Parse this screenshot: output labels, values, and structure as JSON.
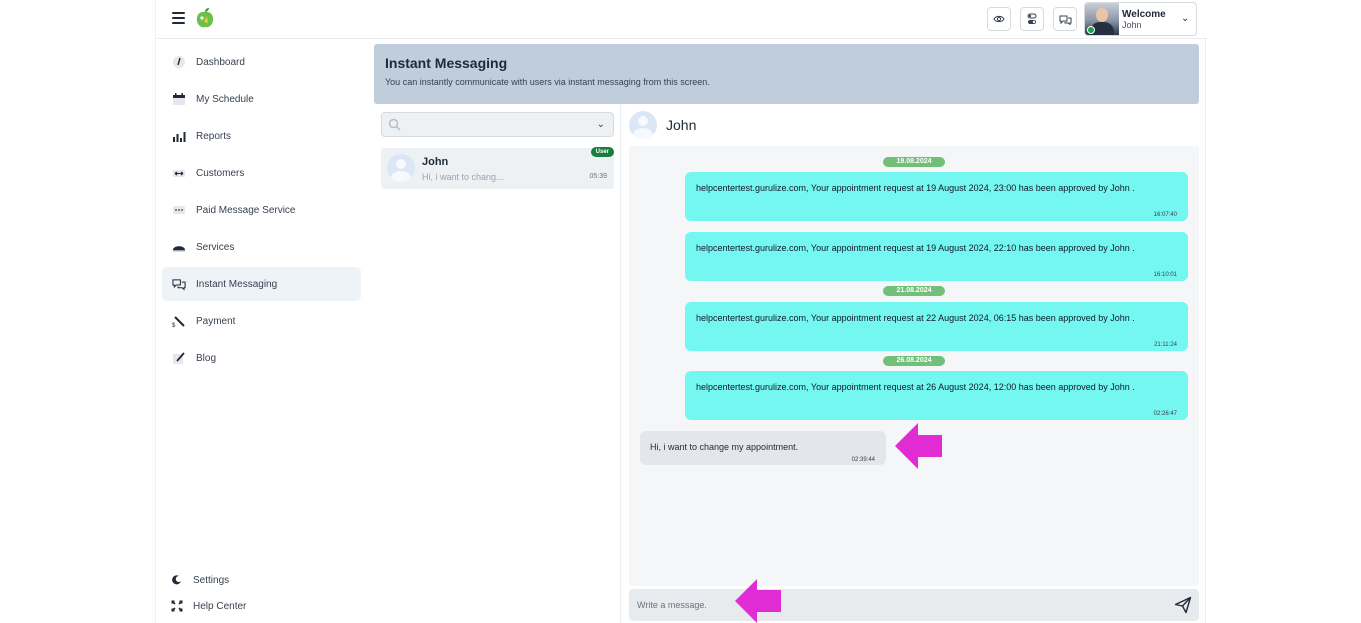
{
  "topbar": {
    "user_welcome": "Welcome",
    "user_name": "John",
    "icons": [
      "eye-icon",
      "toggle-icon",
      "chat-icon"
    ]
  },
  "sidebar": {
    "items": [
      {
        "label": "Dashboard",
        "icon": "dashboard-icon"
      },
      {
        "label": "My Schedule",
        "icon": "calendar-icon"
      },
      {
        "label": "Reports",
        "icon": "bar-chart-icon"
      },
      {
        "label": "Customers",
        "icon": "customers-icon"
      },
      {
        "label": "Paid Message Service",
        "icon": "message-dots-icon"
      },
      {
        "label": "Services",
        "icon": "services-icon"
      },
      {
        "label": "Instant Messaging",
        "icon": "chat-bubbles-icon",
        "active": true
      },
      {
        "label": "Payment",
        "icon": "payment-icon"
      },
      {
        "label": "Blog",
        "icon": "blog-icon"
      }
    ],
    "bottom": [
      {
        "label": "Settings",
        "icon": "settings-icon"
      },
      {
        "label": "Help Center",
        "icon": "help-center-icon"
      }
    ]
  },
  "banner": {
    "title": "Instant Messaging",
    "subtitle": "You can instantly communicate with users via instant messaging from this screen."
  },
  "conversations": [
    {
      "name": "John",
      "preview": "Hi, i want to chang...",
      "time": "05:39",
      "badge": "User"
    }
  ],
  "chat": {
    "contact_name": "John",
    "dates": [
      "19.08.2024",
      "21.08.2024",
      "26.08.2024"
    ],
    "outgoing": [
      {
        "text": "helpcentertest.gurulize.com, Your appointment request at 19 August 2024, 23:00 has been approved by John .",
        "time": "16:07:40"
      },
      {
        "text": "helpcentertest.gurulize.com, Your appointment request at 19 August 2024, 22:10 has been approved by John .",
        "time": "16:10:01"
      },
      {
        "text": "helpcentertest.gurulize.com, Your appointment request at 22 August 2024, 06:15 has been approved by John .",
        "time": "21:11:24"
      },
      {
        "text": "helpcentertest.gurulize.com, Your appointment request at 26 August 2024, 12:00 has been approved by John .",
        "time": "02:26:47"
      }
    ],
    "incoming": [
      {
        "text": "Hi, i want to change my appointment.",
        "time": "02:39:44"
      }
    ],
    "composer_placeholder": "Write a message."
  },
  "colors": {
    "banner": "#c0cedb",
    "outgoing_bubble": "#74f6f1",
    "incoming_bubble": "#e3e6ea",
    "date_pill": "#72bf7a",
    "badge": "#15803d",
    "annotation_arrow": "#e12bd3"
  }
}
